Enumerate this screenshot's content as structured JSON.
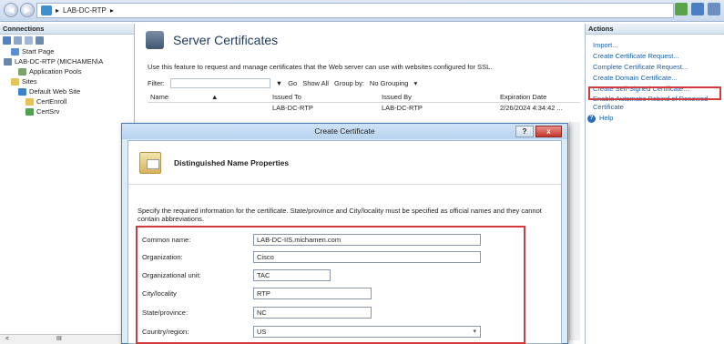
{
  "address": {
    "path": "LAB-DC-RTP",
    "separator": "▸"
  },
  "connections": {
    "header": "Connections",
    "tree": [
      {
        "label": "Start Page",
        "indent": 1,
        "icon": "start-page-icon",
        "color": "#5b8ed0"
      },
      {
        "label": "LAB-DC-RTP (MICHAMEN\\A",
        "indent": 0,
        "icon": "server-icon",
        "color": "#6c88a8"
      },
      {
        "label": "Application Pools",
        "indent": 2,
        "icon": "app-pools-icon",
        "color": "#7aa56a"
      },
      {
        "label": "Sites",
        "indent": 1,
        "icon": "sites-folder-icon",
        "color": "#e3c35a"
      },
      {
        "label": "Default Web Site",
        "indent": 2,
        "icon": "globe-icon",
        "color": "#3b82c6"
      },
      {
        "label": "CertEnroll",
        "indent": 3,
        "icon": "folder-icon",
        "color": "#e3c35a"
      },
      {
        "label": "CertSrv",
        "indent": 3,
        "icon": "app-icon",
        "color": "#4fa14f"
      }
    ],
    "scroll_label": "III"
  },
  "center": {
    "title": "Server Certificates",
    "description": "Use this feature to request and manage certificates that the Web server can use with websites configured for SSL.",
    "filter_label": "Filter:",
    "go_label": "Go",
    "show_all_label": "Show All",
    "group_by_label": "Group by:",
    "group_by_value": "No Grouping",
    "columns": {
      "name": "Name",
      "issued_to": "Issued To",
      "issued_by": "Issued By",
      "expiration": "Expiration Date"
    },
    "row": {
      "name": "",
      "issued_to": "LAB-DC-RTP",
      "issued_by": "LAB-DC-RTP",
      "expiration": "2/26/2024 4:34:42 ..."
    }
  },
  "actions": {
    "header": "Actions",
    "items": [
      "Import...",
      "Create Certificate Request...",
      "Complete Certificate Request...",
      "Create Domain Certificate...",
      "Create Self-Signed Certificate...",
      "Enable Automatic Rebind of Renewed Certificate",
      "Help"
    ]
  },
  "dialog": {
    "title": "Create Certificate",
    "help_button": "?",
    "close_button": "x",
    "page_title": "Distinguished Name Properties",
    "instructions": "Specify the required information for the certificate. State/province and City/locality must be specified as official names and they cannot contain abbreviations.",
    "fields": {
      "common_name": {
        "label": "Common name:",
        "value": "LAB-DC-IIS.michamen.com"
      },
      "organization": {
        "label": "Organization:",
        "value": "Cisco"
      },
      "org_unit": {
        "label": "Organizational unit:",
        "value": "TAC"
      },
      "city": {
        "label": "City/locality",
        "value": "RTP"
      },
      "state": {
        "label": "State/province:",
        "value": "NC"
      },
      "country": {
        "label": "Country/region:",
        "value": "US"
      }
    }
  },
  "colors": {
    "accent_red": "#d4393d",
    "link_blue": "#1a5fa8",
    "dialog_frame": "#dcebf8"
  }
}
